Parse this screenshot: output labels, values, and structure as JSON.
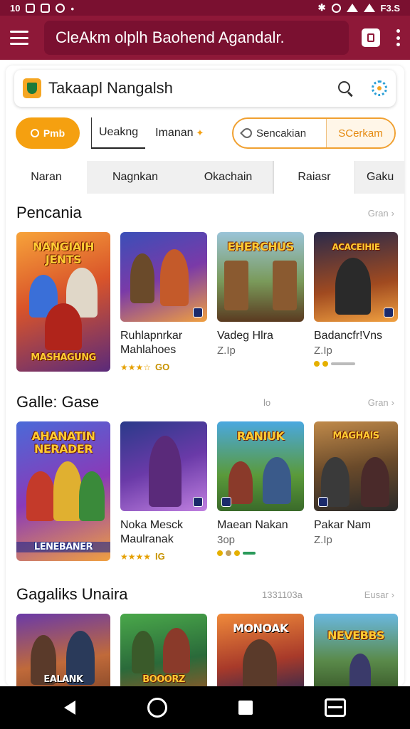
{
  "status_bar": {
    "time": "10",
    "right_text": "F3.S"
  },
  "app_bar": {
    "title": "CleAkm olplh Baohend Agandalr."
  },
  "search": {
    "title": "Takaapl Nangalsh"
  },
  "filters": {
    "orange_pill": "Pmb",
    "tab_active": "Ueakng",
    "tab_plain": "Imanan",
    "outline_left": "Sencakian",
    "outline_right": "SCerkam"
  },
  "categories": [
    "Naran",
    "Nagnkan",
    "Okachain",
    "Raiasr",
    "Gaku"
  ],
  "sections": [
    {
      "title": "Pencania",
      "more": "Gran",
      "cards": [
        {
          "art_top": "NANGIAIH JENTS",
          "art_bottom": "MASHAGUNG",
          "title": "",
          "rating_text": "GO"
        },
        {
          "title": "Ruhlapnrkar Mahlahoes",
          "sub": ""
        },
        {
          "art_top": "EHERCHUS",
          "title": "Vadeg Hlra",
          "sub": "Z.Ip"
        },
        {
          "art_top": "ACACEIHIE",
          "title": "Badancfr!Vns",
          "sub": "Z.Ip"
        }
      ]
    },
    {
      "title": "Galle: Gase",
      "mid": "lo",
      "more": "Gran",
      "cards": [
        {
          "art_top": "AHANATIN NERADER",
          "art_bottom": "LENEBANER",
          "title": "",
          "rating_text": "IG"
        },
        {
          "title": "Noka Mesck Maulranak",
          "sub": ""
        },
        {
          "art_top": "RANIUK",
          "title": "Maean Nakan",
          "sub": "3op"
        },
        {
          "art_top": "MAGHAIS",
          "title": "Pakar Nam",
          "sub": "Z.Ip"
        }
      ]
    },
    {
      "title": "Gagaliks Unaira",
      "mid": "1331103a",
      "more": "Eusar",
      "cards": [
        {
          "art_bottom": "EALANK"
        },
        {
          "art_bottom": "BOOORZ"
        },
        {
          "art_top": "MONOAK"
        },
        {
          "art_top": "NEVEBBS"
        }
      ]
    }
  ],
  "colors": {
    "brand": "#8e1838",
    "accent_orange": "#f5a010"
  }
}
